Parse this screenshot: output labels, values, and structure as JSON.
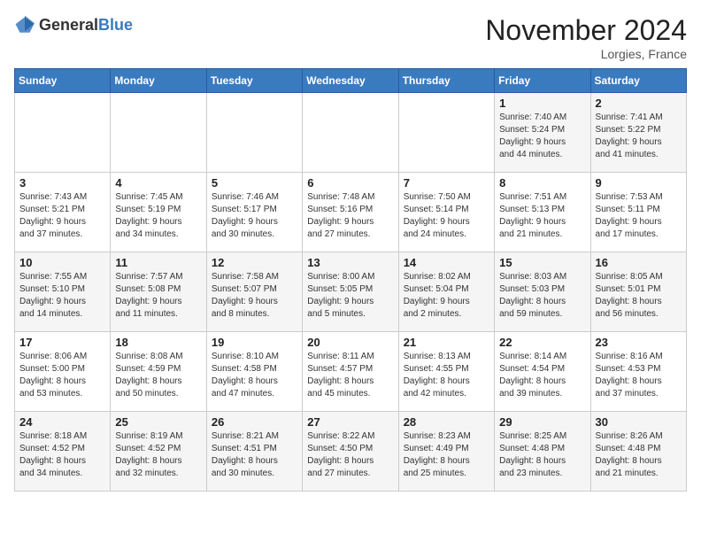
{
  "logo": {
    "text_general": "General",
    "text_blue": "Blue"
  },
  "title": "November 2024",
  "location": "Lorgies, France",
  "weekdays": [
    "Sunday",
    "Monday",
    "Tuesday",
    "Wednesday",
    "Thursday",
    "Friday",
    "Saturday"
  ],
  "weeks": [
    [
      {
        "day": "",
        "info": ""
      },
      {
        "day": "",
        "info": ""
      },
      {
        "day": "",
        "info": ""
      },
      {
        "day": "",
        "info": ""
      },
      {
        "day": "",
        "info": ""
      },
      {
        "day": "1",
        "info": "Sunrise: 7:40 AM\nSunset: 5:24 PM\nDaylight: 9 hours\nand 44 minutes."
      },
      {
        "day": "2",
        "info": "Sunrise: 7:41 AM\nSunset: 5:22 PM\nDaylight: 9 hours\nand 41 minutes."
      }
    ],
    [
      {
        "day": "3",
        "info": "Sunrise: 7:43 AM\nSunset: 5:21 PM\nDaylight: 9 hours\nand 37 minutes."
      },
      {
        "day": "4",
        "info": "Sunrise: 7:45 AM\nSunset: 5:19 PM\nDaylight: 9 hours\nand 34 minutes."
      },
      {
        "day": "5",
        "info": "Sunrise: 7:46 AM\nSunset: 5:17 PM\nDaylight: 9 hours\nand 30 minutes."
      },
      {
        "day": "6",
        "info": "Sunrise: 7:48 AM\nSunset: 5:16 PM\nDaylight: 9 hours\nand 27 minutes."
      },
      {
        "day": "7",
        "info": "Sunrise: 7:50 AM\nSunset: 5:14 PM\nDaylight: 9 hours\nand 24 minutes."
      },
      {
        "day": "8",
        "info": "Sunrise: 7:51 AM\nSunset: 5:13 PM\nDaylight: 9 hours\nand 21 minutes."
      },
      {
        "day": "9",
        "info": "Sunrise: 7:53 AM\nSunset: 5:11 PM\nDaylight: 9 hours\nand 17 minutes."
      }
    ],
    [
      {
        "day": "10",
        "info": "Sunrise: 7:55 AM\nSunset: 5:10 PM\nDaylight: 9 hours\nand 14 minutes."
      },
      {
        "day": "11",
        "info": "Sunrise: 7:57 AM\nSunset: 5:08 PM\nDaylight: 9 hours\nand 11 minutes."
      },
      {
        "day": "12",
        "info": "Sunrise: 7:58 AM\nSunset: 5:07 PM\nDaylight: 9 hours\nand 8 minutes."
      },
      {
        "day": "13",
        "info": "Sunrise: 8:00 AM\nSunset: 5:05 PM\nDaylight: 9 hours\nand 5 minutes."
      },
      {
        "day": "14",
        "info": "Sunrise: 8:02 AM\nSunset: 5:04 PM\nDaylight: 9 hours\nand 2 minutes."
      },
      {
        "day": "15",
        "info": "Sunrise: 8:03 AM\nSunset: 5:03 PM\nDaylight: 8 hours\nand 59 minutes."
      },
      {
        "day": "16",
        "info": "Sunrise: 8:05 AM\nSunset: 5:01 PM\nDaylight: 8 hours\nand 56 minutes."
      }
    ],
    [
      {
        "day": "17",
        "info": "Sunrise: 8:06 AM\nSunset: 5:00 PM\nDaylight: 8 hours\nand 53 minutes."
      },
      {
        "day": "18",
        "info": "Sunrise: 8:08 AM\nSunset: 4:59 PM\nDaylight: 8 hours\nand 50 minutes."
      },
      {
        "day": "19",
        "info": "Sunrise: 8:10 AM\nSunset: 4:58 PM\nDaylight: 8 hours\nand 47 minutes."
      },
      {
        "day": "20",
        "info": "Sunrise: 8:11 AM\nSunset: 4:57 PM\nDaylight: 8 hours\nand 45 minutes."
      },
      {
        "day": "21",
        "info": "Sunrise: 8:13 AM\nSunset: 4:55 PM\nDaylight: 8 hours\nand 42 minutes."
      },
      {
        "day": "22",
        "info": "Sunrise: 8:14 AM\nSunset: 4:54 PM\nDaylight: 8 hours\nand 39 minutes."
      },
      {
        "day": "23",
        "info": "Sunrise: 8:16 AM\nSunset: 4:53 PM\nDaylight: 8 hours\nand 37 minutes."
      }
    ],
    [
      {
        "day": "24",
        "info": "Sunrise: 8:18 AM\nSunset: 4:52 PM\nDaylight: 8 hours\nand 34 minutes."
      },
      {
        "day": "25",
        "info": "Sunrise: 8:19 AM\nSunset: 4:52 PM\nDaylight: 8 hours\nand 32 minutes."
      },
      {
        "day": "26",
        "info": "Sunrise: 8:21 AM\nSunset: 4:51 PM\nDaylight: 8 hours\nand 30 minutes."
      },
      {
        "day": "27",
        "info": "Sunrise: 8:22 AM\nSunset: 4:50 PM\nDaylight: 8 hours\nand 27 minutes."
      },
      {
        "day": "28",
        "info": "Sunrise: 8:23 AM\nSunset: 4:49 PM\nDaylight: 8 hours\nand 25 minutes."
      },
      {
        "day": "29",
        "info": "Sunrise: 8:25 AM\nSunset: 4:48 PM\nDaylight: 8 hours\nand 23 minutes."
      },
      {
        "day": "30",
        "info": "Sunrise: 8:26 AM\nSunset: 4:48 PM\nDaylight: 8 hours\nand 21 minutes."
      }
    ]
  ]
}
